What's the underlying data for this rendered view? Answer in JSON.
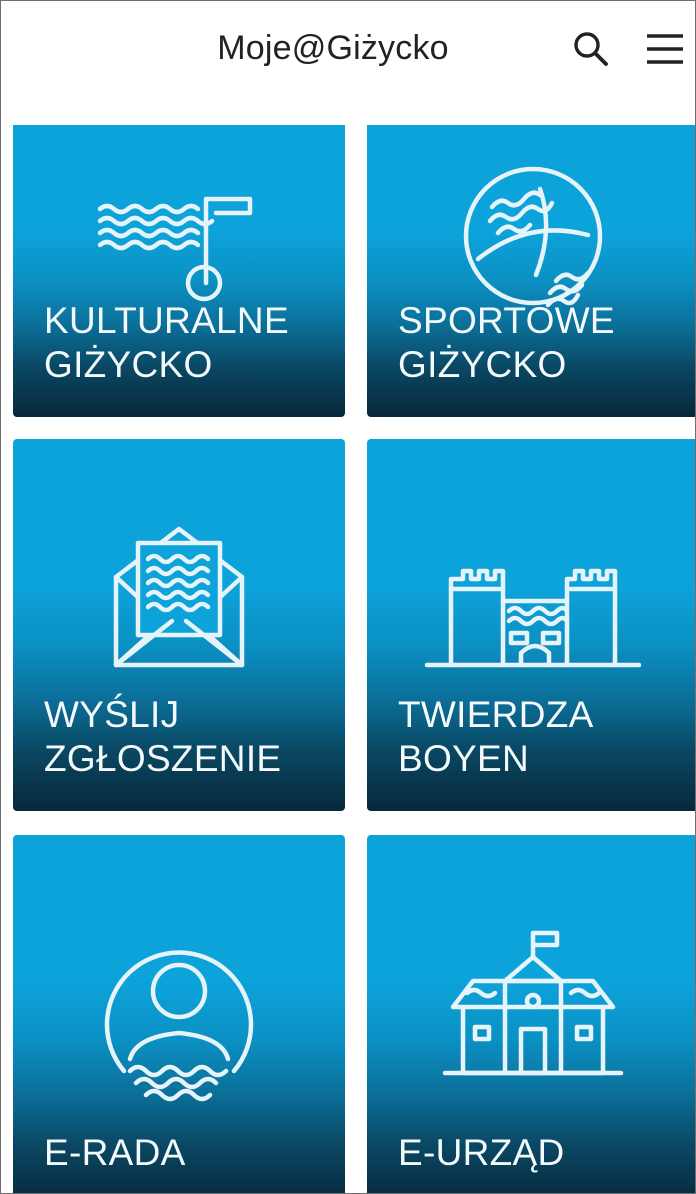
{
  "header": {
    "title": "Moje@Giżycko",
    "search_icon": "search-icon",
    "menu_icon": "hamburger-menu-icon"
  },
  "colors": {
    "tile_top": "#0ca2da",
    "tile_bottom": "#06283a",
    "icon_stroke": "#e6f4fa",
    "header_bg": "#ffffff",
    "title_text": "#222222"
  },
  "tiles": [
    {
      "line1": "KULTURALNE",
      "line2": "GIŻYCKO",
      "icon": "waves-music-note-icon"
    },
    {
      "line1": "SPORTOWE",
      "line2": "GIŻYCKO",
      "icon": "ball-icon"
    },
    {
      "line1": "WYŚLIJ",
      "line2": "ZGŁOSZENIE",
      "icon": "envelope-letter-icon"
    },
    {
      "line1": "TWIERDZA",
      "line2": "BOYEN",
      "icon": "fortress-icon"
    },
    {
      "line1": "E-RADA",
      "line2": "",
      "icon": "person-circle-icon"
    },
    {
      "line1": "E-URZĄD",
      "line2": "",
      "icon": "town-hall-icon"
    }
  ]
}
